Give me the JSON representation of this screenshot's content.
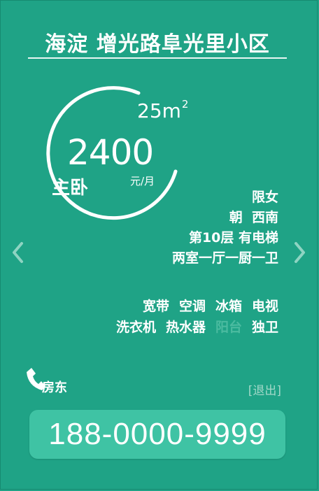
{
  "listing": {
    "title": "海淀 增光路阜光里小区",
    "area_value": "25m",
    "area_unit_sup": "2",
    "price": "2400",
    "price_unit": "元/月",
    "room_type": "主卧",
    "details": [
      "限女",
      "朝  西南",
      "第10层 有电梯",
      "两室一厅一厨一卫"
    ],
    "amenities": [
      [
        {
          "label": "宽带",
          "available": true
        },
        {
          "label": "空调",
          "available": true
        },
        {
          "label": "冰箱",
          "available": true
        },
        {
          "label": "电视",
          "available": true
        }
      ],
      [
        {
          "label": "洗衣机",
          "available": true
        },
        {
          "label": "热水器",
          "available": true
        },
        {
          "label": "阳台",
          "available": false
        },
        {
          "label": "独卫",
          "available": true
        }
      ]
    ]
  },
  "contact": {
    "role_label": "房东",
    "logout_label": "[退出]",
    "phone": "188-0000-9999"
  },
  "icons": {
    "prev": "chevron-left-icon",
    "next": "chevron-right-icon",
    "phone": "phone-handset-icon"
  },
  "colors": {
    "background": "#1fa386",
    "button": "#3fc3a4",
    "unavailable_text": "#4bbba0",
    "logout_text": "#a3d8c9"
  }
}
